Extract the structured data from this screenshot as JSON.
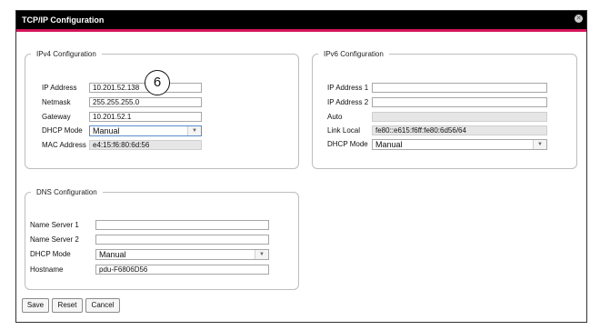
{
  "window": {
    "title": "TCP/IP Configuration",
    "close_icon": "close-icon"
  },
  "callout": "6",
  "ipv4": {
    "legend": "IPv4 Configuration",
    "ip_label": "IP Address",
    "ip_value": "10.201.52.138",
    "netmask_label": "Netmask",
    "netmask_value": "255.255.255.0",
    "gateway_label": "Gateway",
    "gateway_value": "10.201.52.1",
    "dhcp_label": "DHCP Mode",
    "dhcp_value": "Manual",
    "mac_label": "MAC Address",
    "mac_value": "e4:15:f6:80:6d:56"
  },
  "ipv6": {
    "legend": "IPv6 Configuration",
    "ip1_label": "IP Address 1",
    "ip1_value": "",
    "ip2_label": "IP Address 2",
    "ip2_value": "",
    "auto_label": "Auto",
    "auto_value": "",
    "link_label": "Link Local",
    "link_value": "fe80::e615:f6ff:fe80:6d56/64",
    "dhcp_label": "DHCP Mode",
    "dhcp_value": "Manual"
  },
  "dns": {
    "legend": "DNS Configuration",
    "ns1_label": "Name Server 1",
    "ns1_value": "",
    "ns2_label": "Name Server 2",
    "ns2_value": "",
    "dhcp_label": "DHCP Mode",
    "dhcp_value": "Manual",
    "host_label": "Hostname",
    "host_value": "pdu-F6806D56"
  },
  "actions": {
    "save": "Save",
    "reset": "Reset",
    "cancel": "Cancel"
  }
}
